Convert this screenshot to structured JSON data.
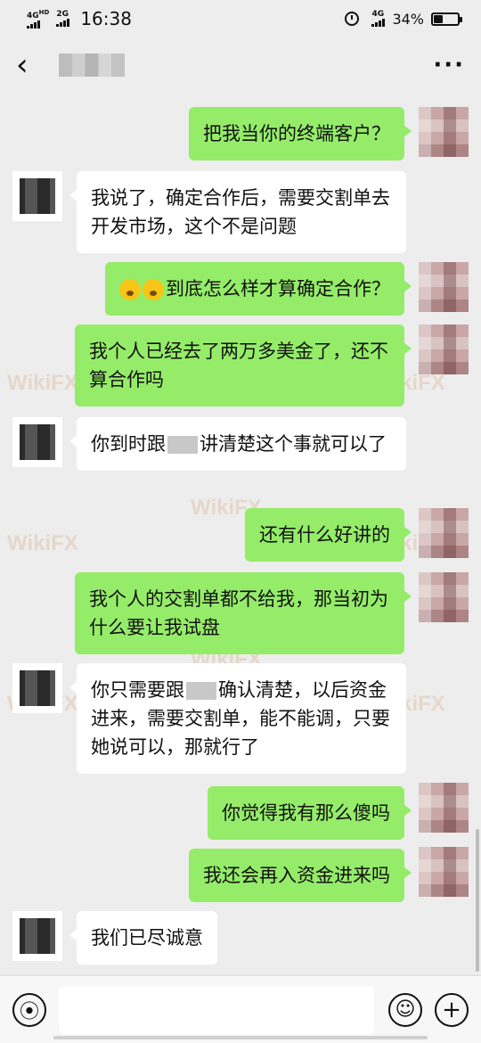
{
  "status_bar": {
    "network_left_1": "4G",
    "network_left_1_sub": "HD",
    "network_left_2": "2G",
    "time": "16:38",
    "network_right": "4G",
    "battery_text": "34%",
    "battery_level": 0.34
  },
  "header": {
    "contact_name_redacted": true
  },
  "messages": [
    {
      "side": "right",
      "text": "把我当你的终端客户？"
    },
    {
      "side": "left",
      "text": "我说了，确定合作后，需要交割单去开发市场，这个不是问题"
    },
    {
      "side": "right",
      "text": "到底怎么样才算确定合作？"
    },
    {
      "side": "right",
      "text": "我个人已经去了两万多美金了，还不算合作吗"
    },
    {
      "side": "left",
      "text_before": "你到时跟",
      "text_after": "讲清楚这个事就可以了"
    },
    {
      "side": "right",
      "text": "还有什么好讲的"
    },
    {
      "side": "right",
      "text": "我个人的交割单都不给我，那当初为什么要让我试盘"
    },
    {
      "side": "left",
      "text_before": "你只需要跟",
      "text_after": "确认清楚，以后资金进来，需要交割单，能不能调，只要她说可以，那就行了"
    },
    {
      "side": "right",
      "text": "你觉得我有那么傻吗"
    },
    {
      "side": "right",
      "text": "我还会再入资金进来吗"
    },
    {
      "side": "left",
      "text": "我们已尽诚意"
    }
  ],
  "watermark": "WikiFX",
  "input_bar": {
    "voice_icon": "voice-icon",
    "emoji_icon": "emoji-icon",
    "plus_icon": "plus-icon"
  }
}
